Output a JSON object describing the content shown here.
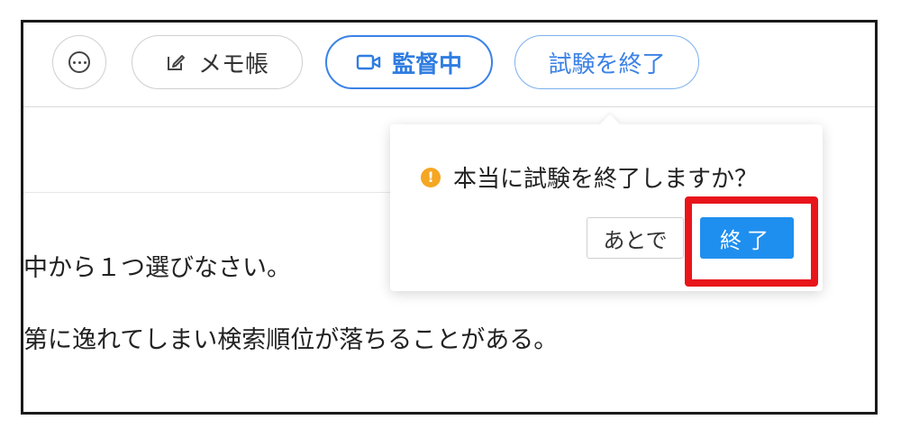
{
  "toolbar": {
    "chat_icon": "chat-bubble-icon",
    "memo_icon": "edit-icon",
    "memo_label": "メモ帳",
    "proctor_icon": "video-camera-icon",
    "proctor_label": "監督中",
    "end_exam_label": "試験を終了"
  },
  "question": {
    "line1": "中から１つ選びなさい。",
    "line2": "第に逸れてしまい検索順位が落ちることがある。"
  },
  "confirm_popover": {
    "warning_icon": "warning-icon",
    "message": "本当に試験を終了しますか？",
    "cancel_label": "あとで",
    "confirm_label": "終了"
  },
  "colors": {
    "accent_blue": "#2f7de1",
    "primary_button": "#1f8fef",
    "warning": "#f5a623",
    "highlight_red": "#e8151b"
  }
}
